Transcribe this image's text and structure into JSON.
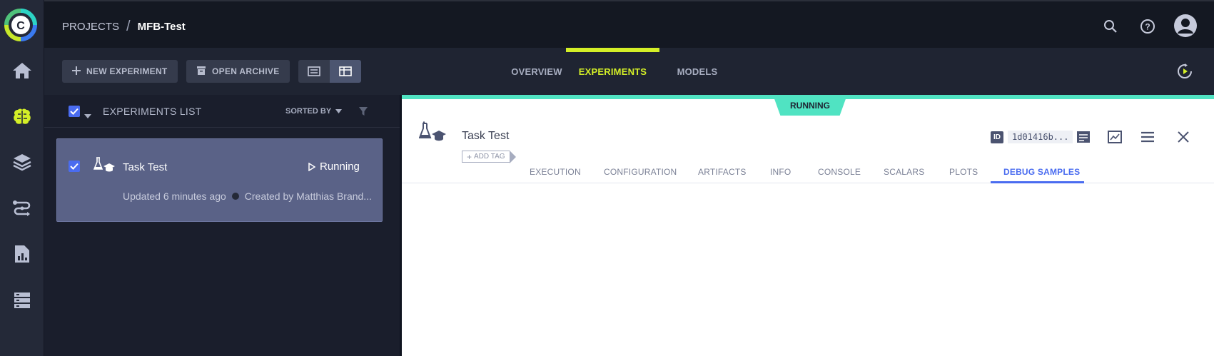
{
  "header": {
    "breadcrumb_root": "PROJECTS",
    "breadcrumb_sep": "/",
    "breadcrumb_current": "MFB-Test"
  },
  "toolbar": {
    "new_experiment": "NEW EXPERIMENT",
    "open_archive": "OPEN ARCHIVE"
  },
  "main_tabs": [
    {
      "label": "OVERVIEW",
      "active": false
    },
    {
      "label": "EXPERIMENTS",
      "active": true
    },
    {
      "label": "MODELS",
      "active": false
    }
  ],
  "list": {
    "title": "EXPERIMENTS LIST",
    "sorted_by": "SORTED BY",
    "items": [
      {
        "name": "Task Test",
        "status": "Running",
        "updated": "Updated 6 minutes ago",
        "created_by": "Created by Matthias Brand..."
      }
    ]
  },
  "detail": {
    "status_badge": "RUNNING",
    "title": "Task Test",
    "add_tag": "ADD TAG",
    "id_label": "ID",
    "id_value": "1d01416b...",
    "tabs": [
      {
        "label": "EXECUTION"
      },
      {
        "label": "CONFIGURATION"
      },
      {
        "label": "ARTIFACTS"
      },
      {
        "label": "INFO"
      },
      {
        "label": "CONSOLE"
      },
      {
        "label": "SCALARS"
      },
      {
        "label": "PLOTS"
      },
      {
        "label": "DEBUG SAMPLES",
        "active": true
      }
    ]
  },
  "colors": {
    "accent_lime": "#d4ef27",
    "running_teal": "#50e3c2",
    "active_blue": "#4a6cf0",
    "selected_card": "#5a6287"
  },
  "icons": [
    "clearml-logo",
    "home-icon",
    "brain-icon",
    "layers-icon",
    "pipelines-icon",
    "reports-icon",
    "datasets-icon",
    "search-icon",
    "help-icon",
    "user-avatar-icon",
    "plus-icon",
    "archive-icon",
    "list-view-icon",
    "details-view-icon",
    "auto-refresh-icon",
    "filter-icon",
    "experiment-icon",
    "play-icon",
    "info-panel-icon",
    "full-screen-icon",
    "menu-icon",
    "close-icon"
  ]
}
